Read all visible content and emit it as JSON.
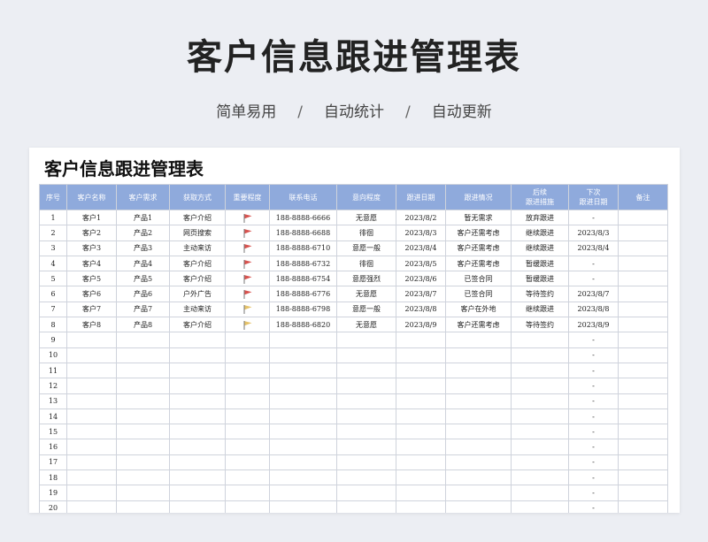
{
  "hero": {
    "title": "客户信息跟进管理表",
    "tags": [
      "简单易用",
      "自动统计",
      "自动更新"
    ],
    "separator": "/"
  },
  "sheet": {
    "title": "客户信息跟进管理表",
    "columns": [
      "序号",
      "客户名称",
      "客户需求",
      "获取方式",
      "重要程度",
      "联系电话",
      "意向程度",
      "跟进日期",
      "跟进情况",
      "后续\n跟进措施",
      "下次\n跟进日期",
      "备注"
    ],
    "colors": {
      "header_bg": "#8faadc",
      "flag_red": "#d9534f",
      "flag_yellow": "#e6c36a"
    },
    "rows": [
      [
        "1",
        "客户1",
        "产品1",
        "客户介绍",
        "red-flag-icon",
        "188-8888-6666",
        "无意愿",
        "2023/8/2",
        "暂无需求",
        "放弃跟进",
        "-",
        ""
      ],
      [
        "2",
        "客户2",
        "产品2",
        "网页搜索",
        "red-flag-icon",
        "188-8888-6688",
        "徘徊",
        "2023/8/3",
        "客户还需考虑",
        "继续跟进",
        "2023/8/3",
        ""
      ],
      [
        "3",
        "客户3",
        "产品3",
        "主动来访",
        "red-flag-icon",
        "188-8888-6710",
        "意愿一般",
        "2023/8/4",
        "客户还需考虑",
        "继续跟进",
        "2023/8/4",
        ""
      ],
      [
        "4",
        "客户4",
        "产品4",
        "客户介绍",
        "red-flag-icon",
        "188-8888-6732",
        "徘徊",
        "2023/8/5",
        "客户还需考虑",
        "暂缓跟进",
        "-",
        ""
      ],
      [
        "5",
        "客户5",
        "产品5",
        "客户介绍",
        "red-flag-icon",
        "188-8888-6754",
        "意愿强烈",
        "2023/8/6",
        "已签合同",
        "暂缓跟进",
        "-",
        ""
      ],
      [
        "6",
        "客户6",
        "产品6",
        "户外广告",
        "red-flag-icon",
        "188-8888-6776",
        "无意愿",
        "2023/8/7",
        "已签合同",
        "等待签约",
        "2023/8/7",
        ""
      ],
      [
        "7",
        "客户7",
        "产品7",
        "主动来访",
        "yellow-flag-icon",
        "188-8888-6798",
        "意愿一般",
        "2023/8/8",
        "客户在外地",
        "继续跟进",
        "2023/8/8",
        ""
      ],
      [
        "8",
        "客户8",
        "产品8",
        "客户介绍",
        "yellow-flag-icon",
        "188-8888-6820",
        "无意愿",
        "2023/8/9",
        "客户还需考虑",
        "等待签约",
        "2023/8/9",
        ""
      ],
      [
        "9",
        "",
        "",
        "",
        "",
        "",
        "",
        "",
        "",
        "",
        "-",
        ""
      ],
      [
        "10",
        "",
        "",
        "",
        "",
        "",
        "",
        "",
        "",
        "",
        "-",
        ""
      ],
      [
        "11",
        "",
        "",
        "",
        "",
        "",
        "",
        "",
        "",
        "",
        "-",
        ""
      ],
      [
        "12",
        "",
        "",
        "",
        "",
        "",
        "",
        "",
        "",
        "",
        "-",
        ""
      ],
      [
        "13",
        "",
        "",
        "",
        "",
        "",
        "",
        "",
        "",
        "",
        "-",
        ""
      ],
      [
        "14",
        "",
        "",
        "",
        "",
        "",
        "",
        "",
        "",
        "",
        "-",
        ""
      ],
      [
        "15",
        "",
        "",
        "",
        "",
        "",
        "",
        "",
        "",
        "",
        "-",
        ""
      ],
      [
        "16",
        "",
        "",
        "",
        "",
        "",
        "",
        "",
        "",
        "",
        "-",
        ""
      ],
      [
        "17",
        "",
        "",
        "",
        "",
        "",
        "",
        "",
        "",
        "",
        "-",
        ""
      ],
      [
        "18",
        "",
        "",
        "",
        "",
        "",
        "",
        "",
        "",
        "",
        "-",
        ""
      ],
      [
        "19",
        "",
        "",
        "",
        "",
        "",
        "",
        "",
        "",
        "",
        "-",
        ""
      ],
      [
        "20",
        "",
        "",
        "",
        "",
        "",
        "",
        "",
        "",
        "",
        "-",
        ""
      ]
    ]
  }
}
